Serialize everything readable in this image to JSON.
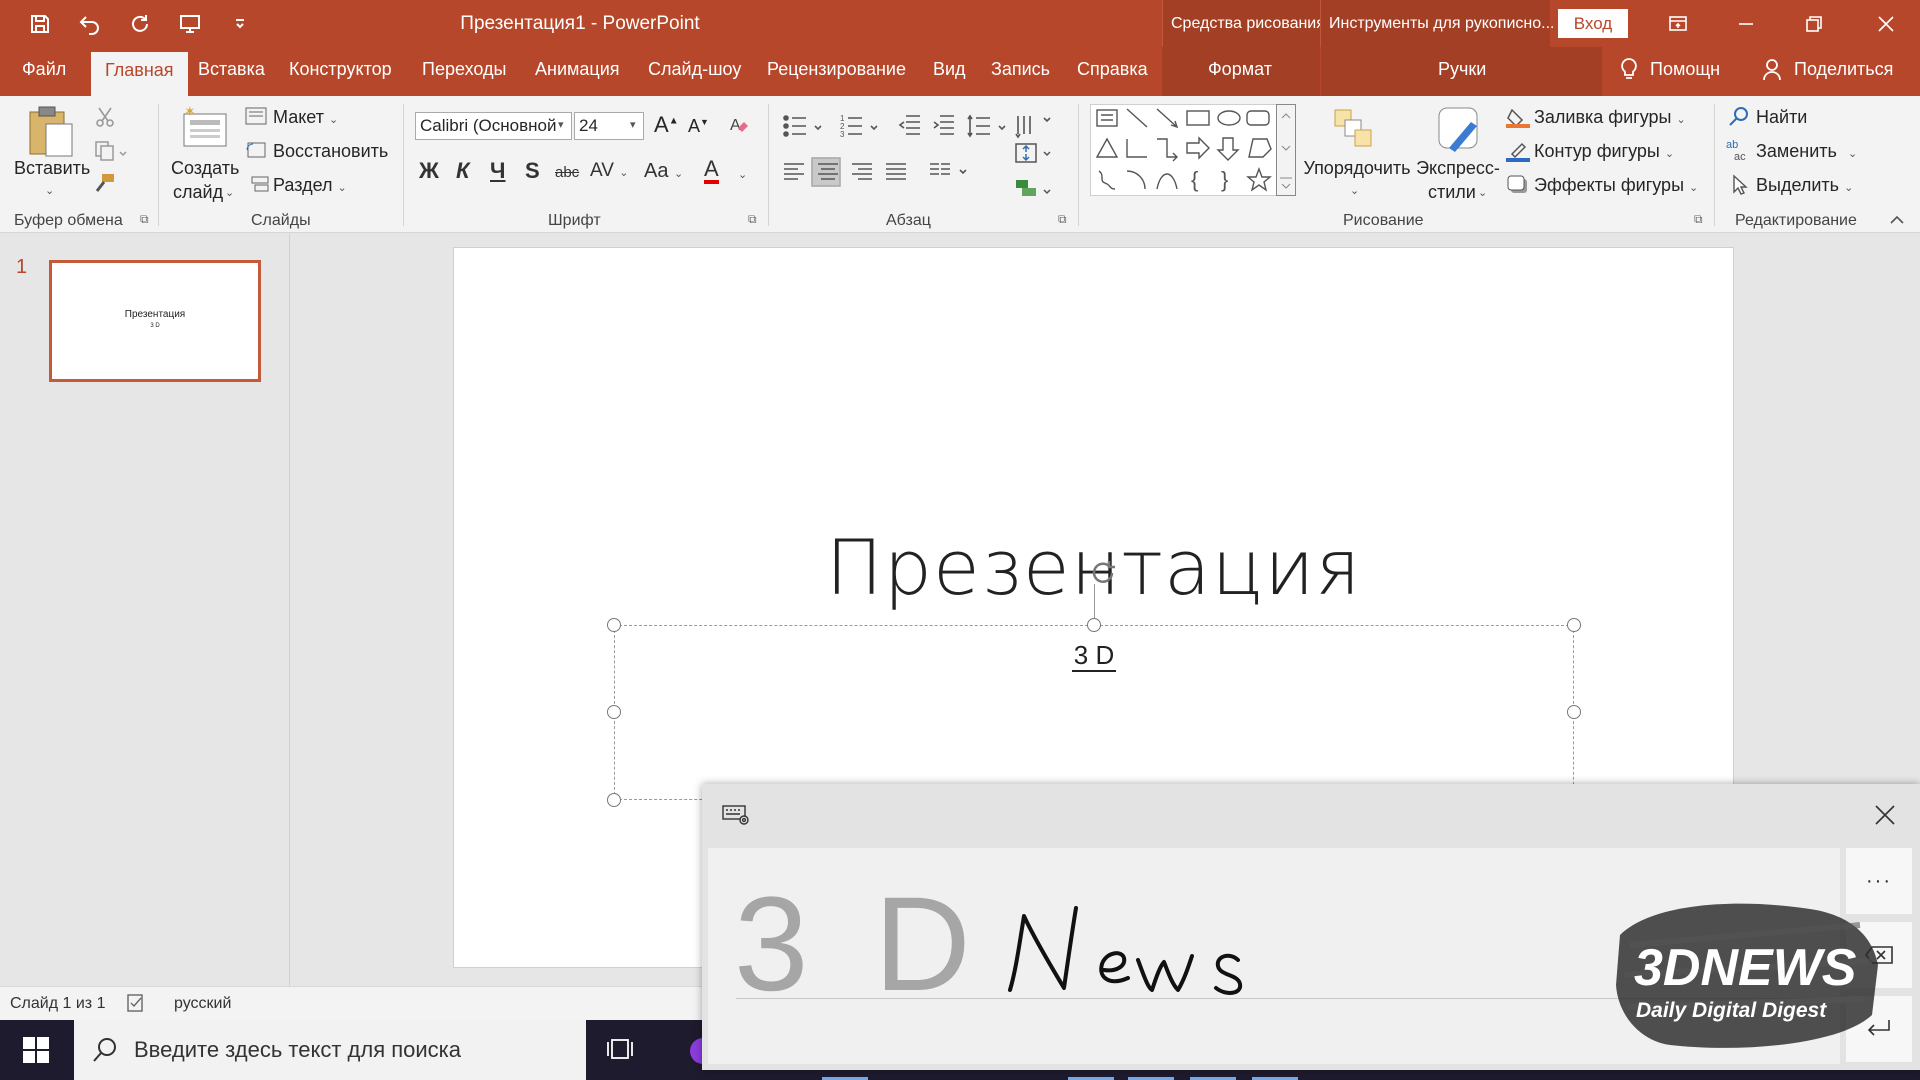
{
  "titlebar": {
    "doc_title": "Презентация1  -  PowerPoint",
    "context_drawing": "Средства рисования",
    "context_ink": "Инструменты для рукописно...",
    "signin": "Вход",
    "accent": "#b7472a"
  },
  "tabs": {
    "file": "Файл",
    "home": "Главная",
    "insert": "Вставка",
    "design": "Конструктор",
    "transitions": "Переходы",
    "animations": "Анимация",
    "slideshow": "Слайд-шоу",
    "review": "Рецензирование",
    "view": "Вид",
    "record": "Запись",
    "help": "Справка",
    "format": "Формат",
    "pens": "Ручки",
    "tell_me": "Помощн",
    "share": "Поделиться"
  },
  "ribbon": {
    "clipboard": {
      "paste": "Вставить",
      "label": "Буфер обмена"
    },
    "slides": {
      "new_slide_1": "Создать",
      "new_slide_2": "слайд",
      "layout": "Макет",
      "reset": "Восстановить",
      "section": "Раздел",
      "label": "Слайды"
    },
    "font": {
      "font_name": "Calibri (Основной",
      "font_size": "24",
      "bold": "Ж",
      "italic": "К",
      "underline": "Ч",
      "shadow": "S",
      "strike": "abc",
      "spacing": "AV",
      "case": "Aa",
      "color": "A",
      "grow": "A",
      "shrink": "A",
      "label": "Шрифт"
    },
    "paragraph": {
      "label": "Абзац"
    },
    "drawing": {
      "arrange": "Упорядочить",
      "styles_1": "Экспресс-",
      "styles_2": "стили",
      "fill": "Заливка фигуры",
      "outline": "Контур фигуры",
      "effects": "Эффекты фигуры",
      "label": "Рисование"
    },
    "editing": {
      "find": "Найти",
      "replace": "Заменить",
      "select": "Выделить",
      "label": "Редактирование"
    }
  },
  "thumbnails": {
    "slide_number": "1",
    "title": "Презентация",
    "subtitle": "3 D"
  },
  "slide": {
    "title": "Презентация",
    "subtitle": "3 D"
  },
  "statusbar": {
    "slide_info": "Слайд 1 из 1",
    "language": "русский"
  },
  "taskbar": {
    "search_placeholder": "Введите здесь текст для поиска"
  },
  "handwriting_panel": {
    "converted_1": "3",
    "converted_2": "D",
    "ink_word": "News",
    "more": "···"
  },
  "watermark": {
    "brand": "3DNEWS",
    "tagline": "Daily Digital Digest"
  }
}
